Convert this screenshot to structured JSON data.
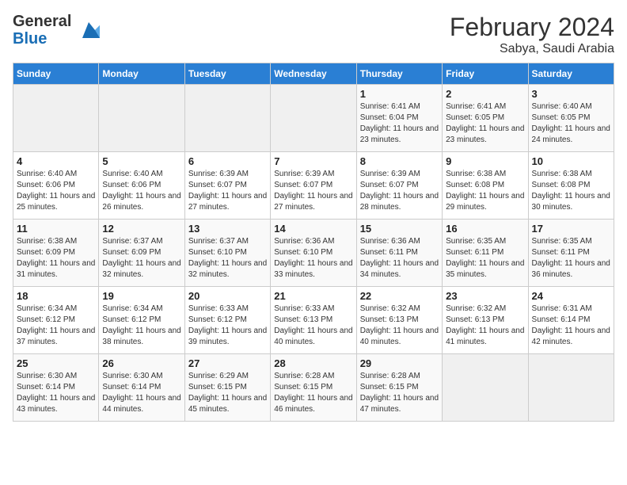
{
  "header": {
    "logo_line1": "General",
    "logo_line2": "Blue",
    "month_year": "February 2024",
    "location": "Sabya, Saudi Arabia"
  },
  "days_of_week": [
    "Sunday",
    "Monday",
    "Tuesday",
    "Wednesday",
    "Thursday",
    "Friday",
    "Saturday"
  ],
  "weeks": [
    [
      {
        "day": "",
        "sunrise": "",
        "sunset": "",
        "daylight": "",
        "empty": true
      },
      {
        "day": "",
        "sunrise": "",
        "sunset": "",
        "daylight": "",
        "empty": true
      },
      {
        "day": "",
        "sunrise": "",
        "sunset": "",
        "daylight": "",
        "empty": true
      },
      {
        "day": "",
        "sunrise": "",
        "sunset": "",
        "daylight": "",
        "empty": true
      },
      {
        "day": "1",
        "sunrise": "Sunrise: 6:41 AM",
        "sunset": "Sunset: 6:04 PM",
        "daylight": "Daylight: 11 hours and 23 minutes.",
        "empty": false
      },
      {
        "day": "2",
        "sunrise": "Sunrise: 6:41 AM",
        "sunset": "Sunset: 6:05 PM",
        "daylight": "Daylight: 11 hours and 23 minutes.",
        "empty": false
      },
      {
        "day": "3",
        "sunrise": "Sunrise: 6:40 AM",
        "sunset": "Sunset: 6:05 PM",
        "daylight": "Daylight: 11 hours and 24 minutes.",
        "empty": false
      }
    ],
    [
      {
        "day": "4",
        "sunrise": "Sunrise: 6:40 AM",
        "sunset": "Sunset: 6:06 PM",
        "daylight": "Daylight: 11 hours and 25 minutes.",
        "empty": false
      },
      {
        "day": "5",
        "sunrise": "Sunrise: 6:40 AM",
        "sunset": "Sunset: 6:06 PM",
        "daylight": "Daylight: 11 hours and 26 minutes.",
        "empty": false
      },
      {
        "day": "6",
        "sunrise": "Sunrise: 6:39 AM",
        "sunset": "Sunset: 6:07 PM",
        "daylight": "Daylight: 11 hours and 27 minutes.",
        "empty": false
      },
      {
        "day": "7",
        "sunrise": "Sunrise: 6:39 AM",
        "sunset": "Sunset: 6:07 PM",
        "daylight": "Daylight: 11 hours and 27 minutes.",
        "empty": false
      },
      {
        "day": "8",
        "sunrise": "Sunrise: 6:39 AM",
        "sunset": "Sunset: 6:07 PM",
        "daylight": "Daylight: 11 hours and 28 minutes.",
        "empty": false
      },
      {
        "day": "9",
        "sunrise": "Sunrise: 6:38 AM",
        "sunset": "Sunset: 6:08 PM",
        "daylight": "Daylight: 11 hours and 29 minutes.",
        "empty": false
      },
      {
        "day": "10",
        "sunrise": "Sunrise: 6:38 AM",
        "sunset": "Sunset: 6:08 PM",
        "daylight": "Daylight: 11 hours and 30 minutes.",
        "empty": false
      }
    ],
    [
      {
        "day": "11",
        "sunrise": "Sunrise: 6:38 AM",
        "sunset": "Sunset: 6:09 PM",
        "daylight": "Daylight: 11 hours and 31 minutes.",
        "empty": false
      },
      {
        "day": "12",
        "sunrise": "Sunrise: 6:37 AM",
        "sunset": "Sunset: 6:09 PM",
        "daylight": "Daylight: 11 hours and 32 minutes.",
        "empty": false
      },
      {
        "day": "13",
        "sunrise": "Sunrise: 6:37 AM",
        "sunset": "Sunset: 6:10 PM",
        "daylight": "Daylight: 11 hours and 32 minutes.",
        "empty": false
      },
      {
        "day": "14",
        "sunrise": "Sunrise: 6:36 AM",
        "sunset": "Sunset: 6:10 PM",
        "daylight": "Daylight: 11 hours and 33 minutes.",
        "empty": false
      },
      {
        "day": "15",
        "sunrise": "Sunrise: 6:36 AM",
        "sunset": "Sunset: 6:11 PM",
        "daylight": "Daylight: 11 hours and 34 minutes.",
        "empty": false
      },
      {
        "day": "16",
        "sunrise": "Sunrise: 6:35 AM",
        "sunset": "Sunset: 6:11 PM",
        "daylight": "Daylight: 11 hours and 35 minutes.",
        "empty": false
      },
      {
        "day": "17",
        "sunrise": "Sunrise: 6:35 AM",
        "sunset": "Sunset: 6:11 PM",
        "daylight": "Daylight: 11 hours and 36 minutes.",
        "empty": false
      }
    ],
    [
      {
        "day": "18",
        "sunrise": "Sunrise: 6:34 AM",
        "sunset": "Sunset: 6:12 PM",
        "daylight": "Daylight: 11 hours and 37 minutes.",
        "empty": false
      },
      {
        "day": "19",
        "sunrise": "Sunrise: 6:34 AM",
        "sunset": "Sunset: 6:12 PM",
        "daylight": "Daylight: 11 hours and 38 minutes.",
        "empty": false
      },
      {
        "day": "20",
        "sunrise": "Sunrise: 6:33 AM",
        "sunset": "Sunset: 6:12 PM",
        "daylight": "Daylight: 11 hours and 39 minutes.",
        "empty": false
      },
      {
        "day": "21",
        "sunrise": "Sunrise: 6:33 AM",
        "sunset": "Sunset: 6:13 PM",
        "daylight": "Daylight: 11 hours and 40 minutes.",
        "empty": false
      },
      {
        "day": "22",
        "sunrise": "Sunrise: 6:32 AM",
        "sunset": "Sunset: 6:13 PM",
        "daylight": "Daylight: 11 hours and 40 minutes.",
        "empty": false
      },
      {
        "day": "23",
        "sunrise": "Sunrise: 6:32 AM",
        "sunset": "Sunset: 6:13 PM",
        "daylight": "Daylight: 11 hours and 41 minutes.",
        "empty": false
      },
      {
        "day": "24",
        "sunrise": "Sunrise: 6:31 AM",
        "sunset": "Sunset: 6:14 PM",
        "daylight": "Daylight: 11 hours and 42 minutes.",
        "empty": false
      }
    ],
    [
      {
        "day": "25",
        "sunrise": "Sunrise: 6:30 AM",
        "sunset": "Sunset: 6:14 PM",
        "daylight": "Daylight: 11 hours and 43 minutes.",
        "empty": false
      },
      {
        "day": "26",
        "sunrise": "Sunrise: 6:30 AM",
        "sunset": "Sunset: 6:14 PM",
        "daylight": "Daylight: 11 hours and 44 minutes.",
        "empty": false
      },
      {
        "day": "27",
        "sunrise": "Sunrise: 6:29 AM",
        "sunset": "Sunset: 6:15 PM",
        "daylight": "Daylight: 11 hours and 45 minutes.",
        "empty": false
      },
      {
        "day": "28",
        "sunrise": "Sunrise: 6:28 AM",
        "sunset": "Sunset: 6:15 PM",
        "daylight": "Daylight: 11 hours and 46 minutes.",
        "empty": false
      },
      {
        "day": "29",
        "sunrise": "Sunrise: 6:28 AM",
        "sunset": "Sunset: 6:15 PM",
        "daylight": "Daylight: 11 hours and 47 minutes.",
        "empty": false
      },
      {
        "day": "",
        "sunrise": "",
        "sunset": "",
        "daylight": "",
        "empty": true
      },
      {
        "day": "",
        "sunrise": "",
        "sunset": "",
        "daylight": "",
        "empty": true
      }
    ]
  ]
}
